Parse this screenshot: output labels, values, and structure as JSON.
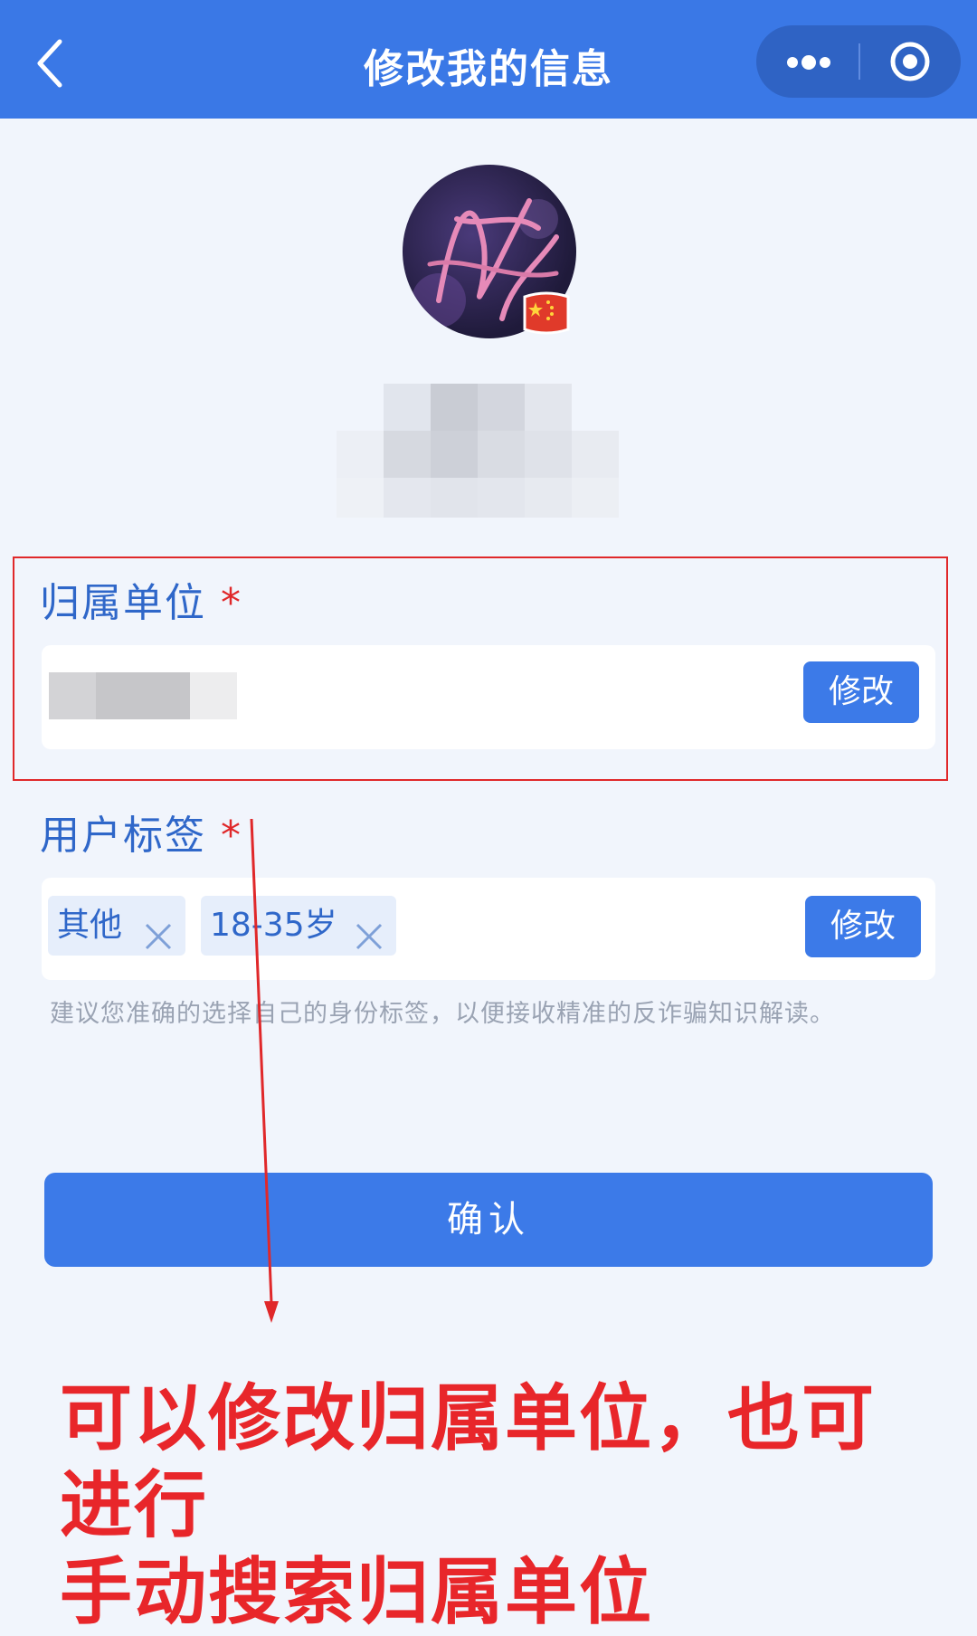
{
  "header": {
    "title": "修改我的信息"
  },
  "affiliation": {
    "label": "归属单位",
    "required_mark": "*",
    "modify_label": "修改"
  },
  "user_tags": {
    "label": "用户标签",
    "required_mark": "*",
    "tags": [
      {
        "text": "其他"
      },
      {
        "text": "18-35岁"
      }
    ],
    "modify_label": "修改",
    "hint": "建议您准确的选择自己的身份标签，以便接收精准的反诈骗知识解读。"
  },
  "confirm_label": "确认",
  "annotation": {
    "line1": "可以修改归属单位，也可进行",
    "line2": "手动搜索归属单位"
  },
  "colors": {
    "primary": "#3a78e6",
    "annotation_red": "#e8262a",
    "label_blue": "#2f67c9"
  }
}
